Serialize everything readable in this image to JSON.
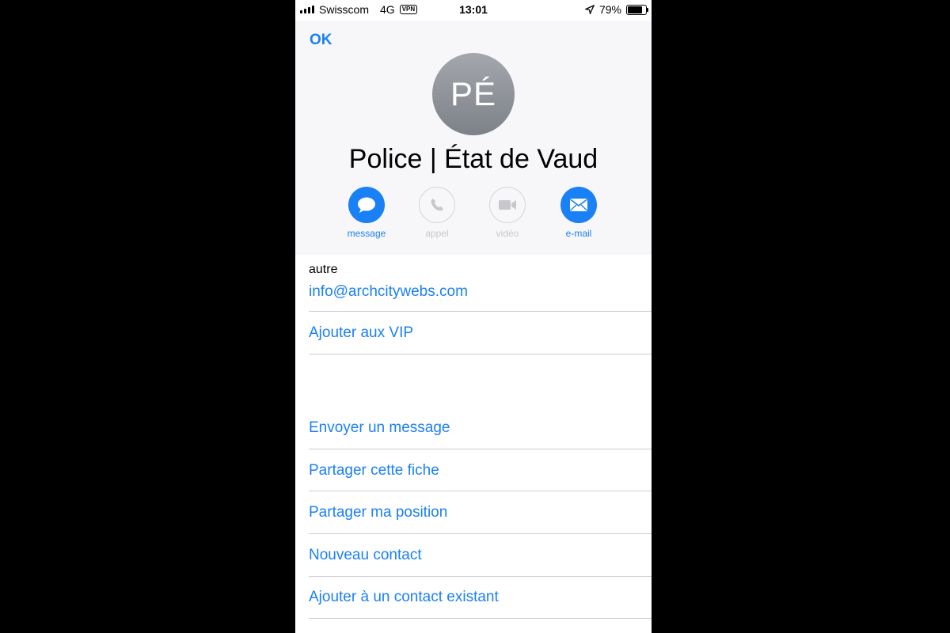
{
  "status_bar": {
    "carrier": "Swisscom",
    "network": "4G",
    "vpn": "VPN",
    "time": "13:01",
    "battery": "79%"
  },
  "header": {
    "ok_label": "OK",
    "avatar_initials": "PÉ",
    "contact_name": "Police | État de Vaud",
    "actions": [
      {
        "label": "message",
        "enabled": true,
        "icon": "message-bubble-icon"
      },
      {
        "label": "appel",
        "enabled": false,
        "icon": "phone-icon"
      },
      {
        "label": "vidéo",
        "enabled": false,
        "icon": "video-camera-icon"
      },
      {
        "label": "e-mail",
        "enabled": true,
        "icon": "mail-icon"
      }
    ]
  },
  "email_section": {
    "label": "autre",
    "value": "info@archcitywebs.com"
  },
  "vip_action": "Ajouter aux VIP",
  "menu_items": [
    "Envoyer un message",
    "Partager cette fiche",
    "Partager ma position",
    "Nouveau contact",
    "Ajouter à un contact existant"
  ],
  "colors": {
    "accent": "#1a80f5",
    "separator": "#cfcfd3",
    "header_bg": "#f7f7f9",
    "avatar": "#8e9197"
  }
}
